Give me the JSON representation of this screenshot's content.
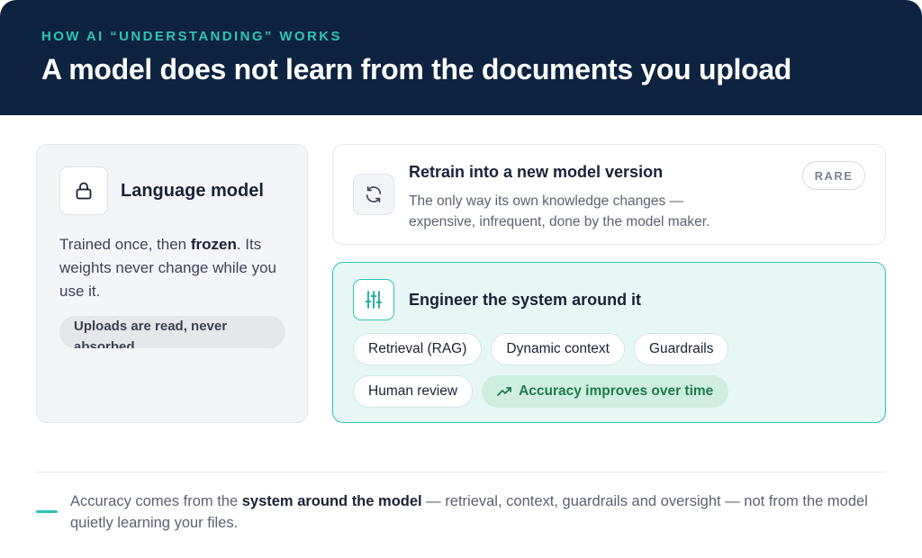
{
  "header": {
    "eyebrow": "HOW AI “UNDERSTANDING” WORKS",
    "headline": "A model does not learn from the documents you upload"
  },
  "language_model": {
    "icon": "lock-icon",
    "title": "Language model",
    "body_pre": "Trained once, then ",
    "body_bold": "frozen",
    "body_post": ". Its weights never change while you use it.",
    "pill": "Uploads are read, never absorbed"
  },
  "retrain": {
    "icon": "refresh-icon",
    "title": "Retrain into a new model version",
    "description": "The only way its own knowledge changes — expensive, infrequent, done by the model maker.",
    "badge": "RARE"
  },
  "engineer": {
    "icon": "sliders-icon",
    "title": "Engineer the system around it",
    "chips": [
      "Retrieval (RAG)",
      "Dynamic context",
      "Guardrails",
      "Human review"
    ],
    "accent_chip": "Accuracy improves over time",
    "accent_icon": "trend-up-icon"
  },
  "footer": {
    "pre": "Accuracy comes from the ",
    "bold": "system around the model",
    "post": " — retrieval, context, guardrails and oversight — not from the model quietly learning your files."
  },
  "colors": {
    "navy": "#0d2340",
    "teal": "#2ec4b6",
    "green": "#1e7a4f"
  }
}
